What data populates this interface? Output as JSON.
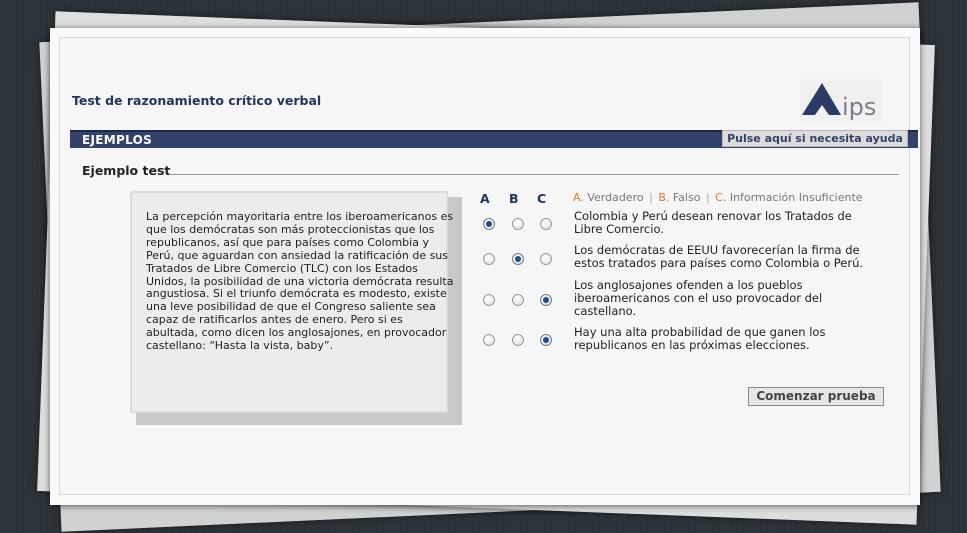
{
  "header": {
    "title": "Test de razonamiento crítico verbal",
    "logo_text": "ips"
  },
  "band": {
    "label": "EJEMPLOS",
    "help_label": "Pulse aquí si necesita ayuda"
  },
  "section": {
    "title": "Ejemplo test"
  },
  "passage": {
    "text": "La percepción mayoritaria entre los iberoamericanos es que los demócratas son más proteccionistas que los republicanos, así que para países como Colombia y Perú, que aguardan con ansiedad la ratificación de sus Tratados de Libre Comercio (TLC) con los Estados Unidos, la posibilidad de una victoria demócrata resulta angustiosa. Si el triunfo demócrata es modesto, existe una leve posibilidad de que el Congreso saliente sea capaz de ratificarlos antes de enero. Pero si es abultada, como dicen los anglosajones, en provocador castellano: “Hasta la vista, baby”."
  },
  "columns": [
    "A",
    "B",
    "C"
  ],
  "legend": {
    "a_key": "A.",
    "a_text": "Verdadero",
    "b_key": "B.",
    "b_text": "Falso",
    "c_key": "C.",
    "c_text": "Información Insuficiente",
    "separator": "|"
  },
  "questions": [
    {
      "text": "Colombia y Perú desean renovar los Tratados de Libre Comercio.",
      "selected": "A"
    },
    {
      "text": "Los demócratas de EEUU favorecerían la firma de estos tratados para países como Colombia o Perú.",
      "selected": "B"
    },
    {
      "text": "Los anglosajones ofenden a los pueblos iberoamericanos con el uso provocador del castellano.",
      "selected": "C"
    },
    {
      "text": "Hay una alta probabilidad de que ganen los republicanos en las próximas elecciones.",
      "selected": "C"
    }
  ],
  "actions": {
    "start_label": "Comenzar prueba"
  },
  "colors": {
    "brand_navy": "#34426b",
    "accent_orange": "#e07a24",
    "radio_selected": "#1f4f8a"
  }
}
